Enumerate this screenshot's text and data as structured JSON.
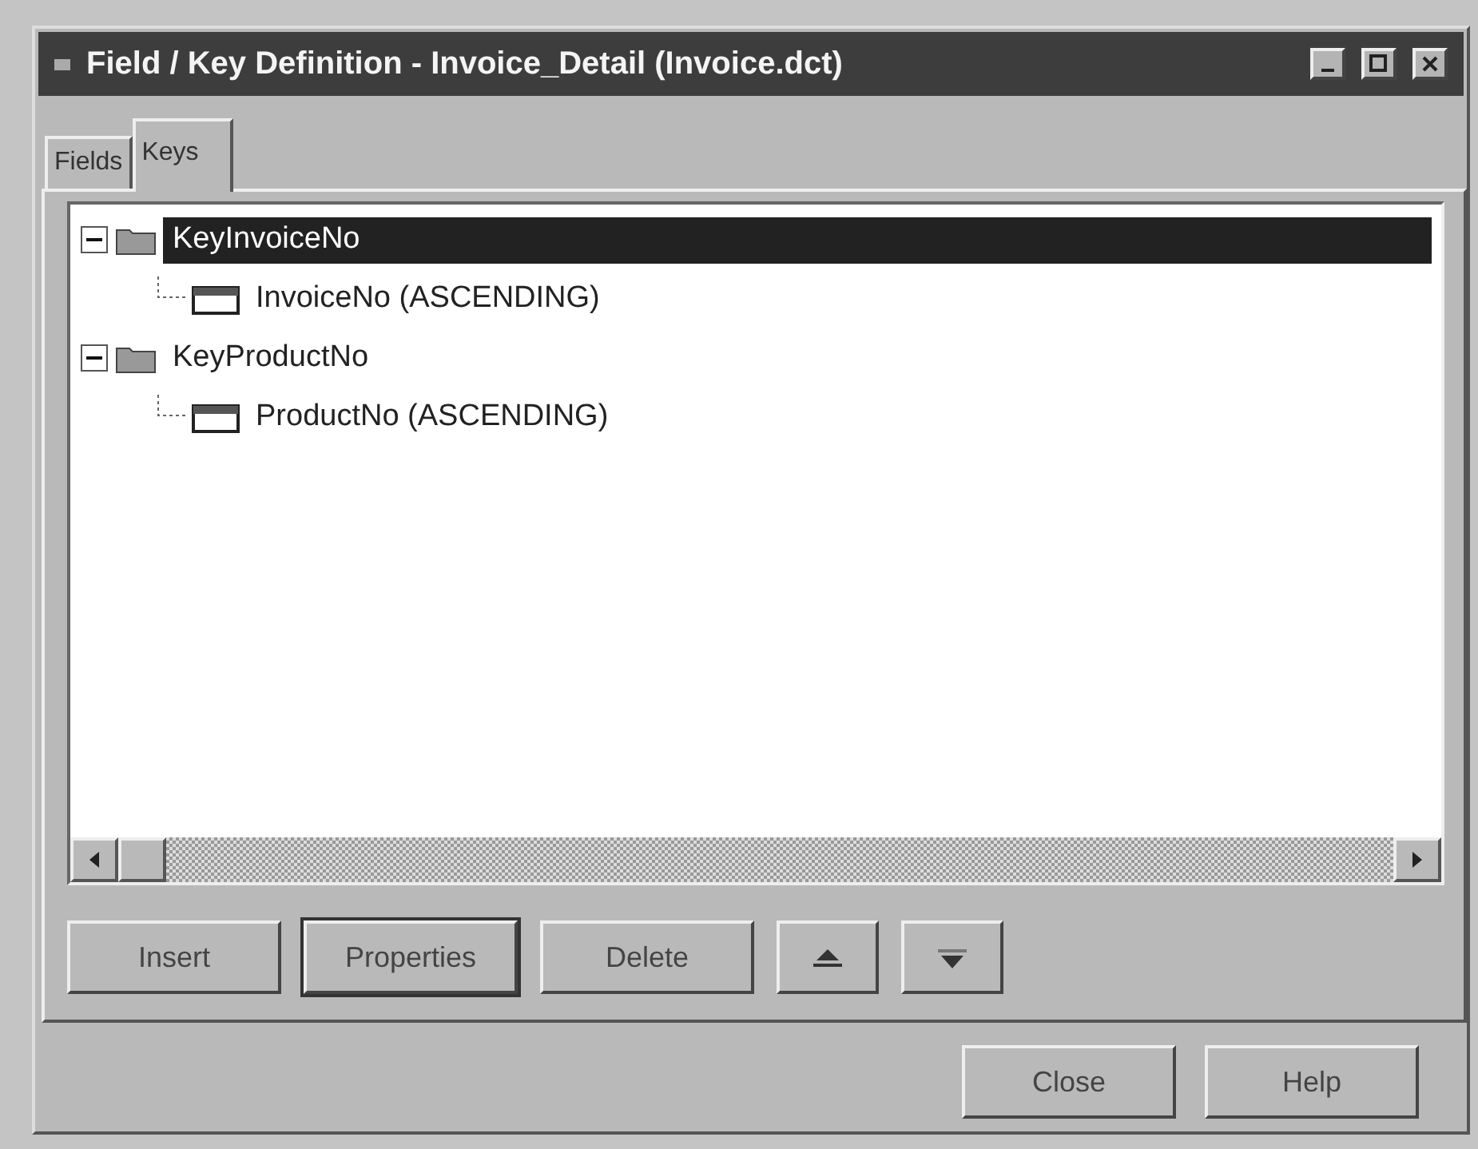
{
  "window": {
    "title": "Field / Key Definition - Invoice_Detail (Invoice.dct)"
  },
  "tabs": [
    {
      "label": "Fields",
      "selected": false
    },
    {
      "label": "Keys",
      "selected": true
    }
  ],
  "tree": [
    {
      "kind": "key",
      "label": "KeyInvoiceNo",
      "expanded": true,
      "selected": true,
      "children": [
        {
          "kind": "field",
          "label": "InvoiceNo (ASCENDING)",
          "selected": false
        }
      ]
    },
    {
      "kind": "key",
      "label": "KeyProductNo",
      "expanded": true,
      "selected": false,
      "children": [
        {
          "kind": "field",
          "label": "ProductNo (ASCENDING)",
          "selected": false
        }
      ]
    }
  ],
  "panel_buttons": [
    {
      "kind": "text",
      "label": "Insert",
      "default": false
    },
    {
      "kind": "text",
      "label": "Properties",
      "default": true
    },
    {
      "kind": "text",
      "label": "Delete",
      "default": false
    },
    {
      "kind": "up"
    },
    {
      "kind": "down"
    }
  ],
  "dialog_buttons": [
    {
      "label": "Close"
    },
    {
      "label": "Help"
    }
  ]
}
